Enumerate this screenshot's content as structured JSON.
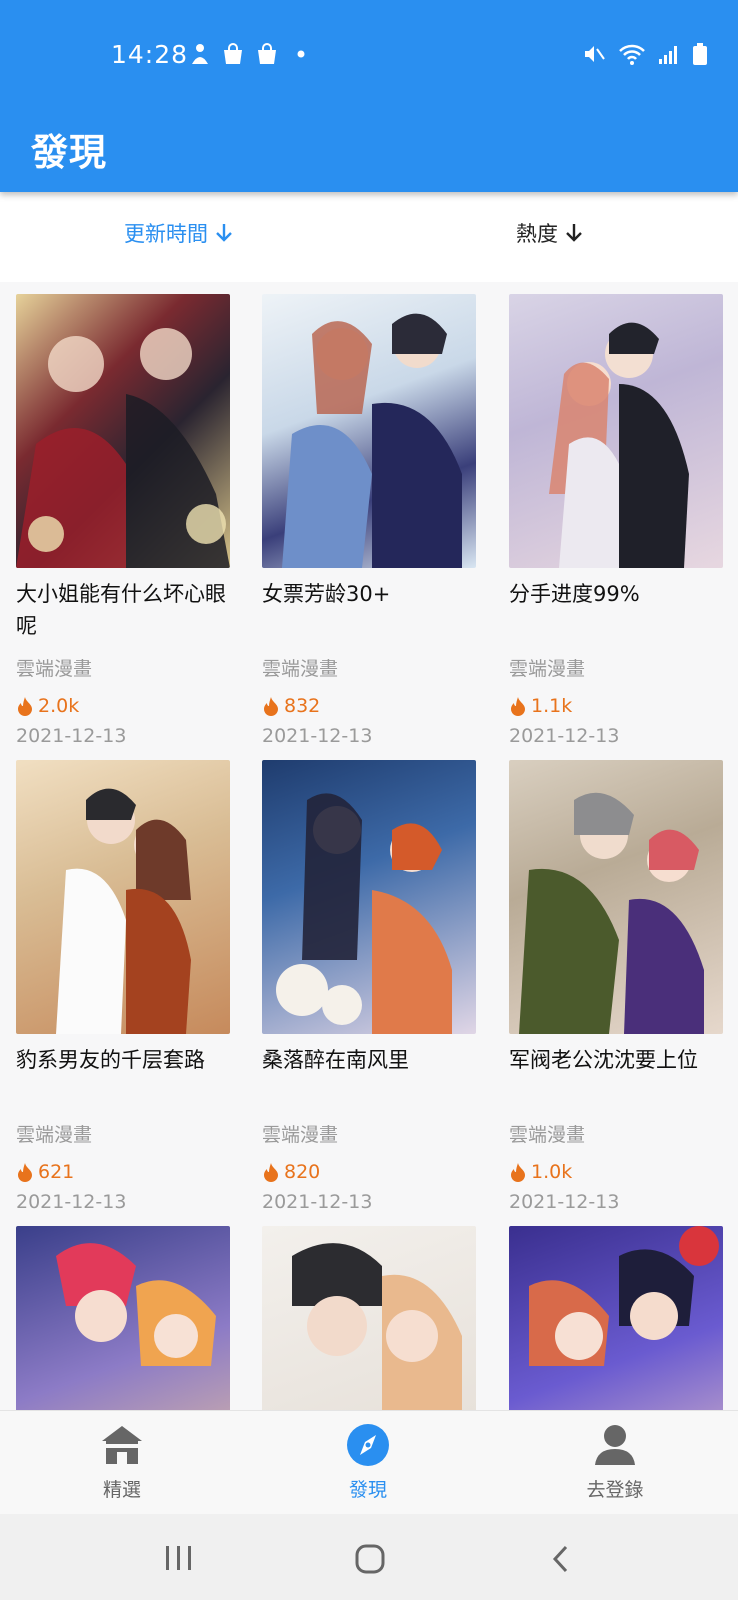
{
  "status_bar": {
    "time": "14:28"
  },
  "app_bar": {
    "title": "發現"
  },
  "sort": {
    "by_time": "更新時間",
    "by_heat": "熱度"
  },
  "items": [
    {
      "title": "大小姐能有什么坏心眼呢",
      "source": "雲端漫畫",
      "heat": "2.0k",
      "date": "2021-12-13"
    },
    {
      "title": "女票芳龄30+",
      "source": "雲端漫畫",
      "heat": "832",
      "date": "2021-12-13"
    },
    {
      "title": "分手进度99%",
      "source": "雲端漫畫",
      "heat": "1.1k",
      "date": "2021-12-13"
    },
    {
      "title": "豹系男友的千层套路",
      "source": "雲端漫畫",
      "heat": "621",
      "date": "2021-12-13"
    },
    {
      "title": "桑落醉在南风里",
      "source": "雲端漫畫",
      "heat": "820",
      "date": "2021-12-13"
    },
    {
      "title": "军阀老公沈沈要上位",
      "source": "雲端漫畫",
      "heat": "1.0k",
      "date": "2021-12-13"
    }
  ],
  "bottom_nav": {
    "featured": "精選",
    "discover": "發現",
    "login": "去登錄"
  },
  "colors": {
    "primary": "#2a8ff0",
    "heat": "#e8731c"
  }
}
